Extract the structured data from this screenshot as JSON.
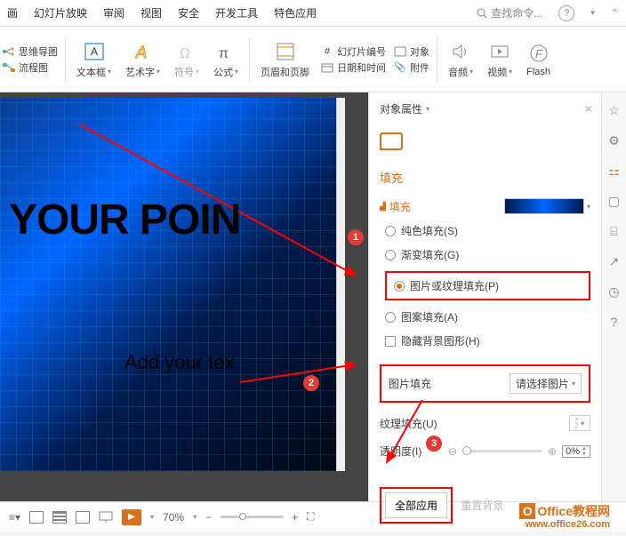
{
  "menubar": {
    "items": [
      "画",
      "幻灯片放映",
      "审阅",
      "视图",
      "安全",
      "开发工具",
      "特色应用"
    ],
    "search_placeholder": "查找命令..."
  },
  "ribbon": {
    "mindmap": "思维导图",
    "flowchart": "流程图",
    "textbox": "文本框",
    "wordart": "艺术字",
    "symbol": "符号",
    "formula": "公式",
    "header_footer": "页眉和页脚",
    "slide_number": "幻灯片编号",
    "datetime": "日期和时间",
    "object": "对象",
    "attachment": "附件",
    "audio": "音频",
    "video": "视频",
    "flash": "Flash"
  },
  "panel": {
    "title": "对象属性",
    "tab_fill": "填充",
    "section_fill": "填充",
    "opt_solid": "纯色填充(S)",
    "opt_gradient": "渐变填充(G)",
    "opt_picture": "图片或纹理填充(P)",
    "opt_pattern": "图案填充(A)",
    "opt_hide_bg": "隐藏背景图形(H)",
    "pic_fill_label": "图片填充",
    "pic_fill_select": "请选择图片",
    "texture_label": "纹理填充(U)",
    "opacity_label": "透明度(I)",
    "opacity_value": "0%",
    "apply_all": "全部应用",
    "reset_bg": "重置背景"
  },
  "slide": {
    "title": "YOUR POIN",
    "subtitle": "Add your tex"
  },
  "statusbar": {
    "zoom": "70%"
  },
  "annotations": {
    "n1": "1",
    "n2": "2",
    "n3": "3"
  },
  "watermark": {
    "name": "Office教程网",
    "url": "www.office26.com"
  }
}
